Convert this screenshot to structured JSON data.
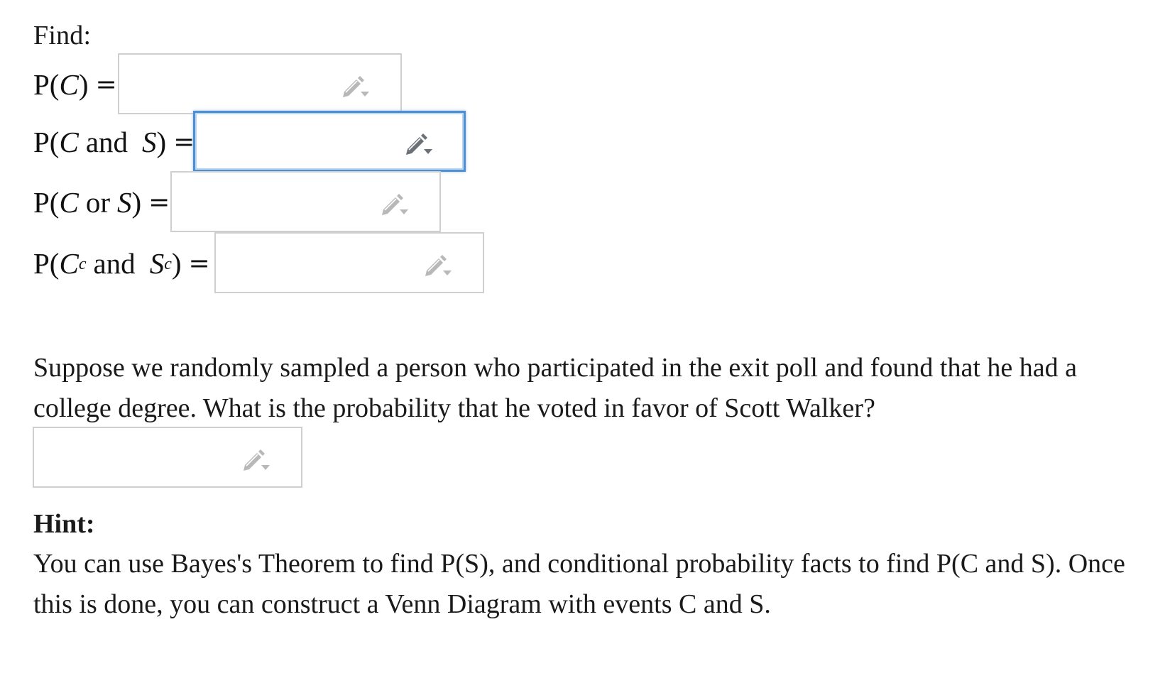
{
  "find_label": "Find:",
  "equations": [
    {
      "id": "p-c",
      "lhs_parts": [
        "P(",
        "C",
        ")"
      ],
      "equals": "=",
      "value": "",
      "active": false
    },
    {
      "id": "p-c-and-s",
      "lhs_parts": [
        "P(",
        "C",
        "and",
        "S",
        ")"
      ],
      "equals": "=",
      "value": "",
      "active": true
    },
    {
      "id": "p-c-or-s",
      "lhs_parts": [
        "P(",
        "C",
        "or",
        "S",
        ")"
      ],
      "equals": "=",
      "value": "",
      "active": false
    },
    {
      "id": "p-cc-and-sc",
      "lhs_parts": [
        "P(",
        "C",
        "c",
        "and",
        "S",
        "c",
        ")"
      ],
      "equals": "=",
      "value": "",
      "active": false
    }
  ],
  "question": {
    "text": "Suppose we randomly sampled a person who participated in the exit poll and found that he had a college degree. What is the probability that he voted in favor of Scott Walker?",
    "answer_value": ""
  },
  "hint": {
    "title": "Hint:",
    "text": "You can use Bayes's Theorem to find P(S), and conditional probability facts to find P(C and S). Once this is done, you can construct a Venn Diagram with events C and S."
  },
  "icons": {
    "input_icon": "pencil-dropdown-icon",
    "inactive_color": "#b8b8b8",
    "active_color": "#6b7079"
  }
}
